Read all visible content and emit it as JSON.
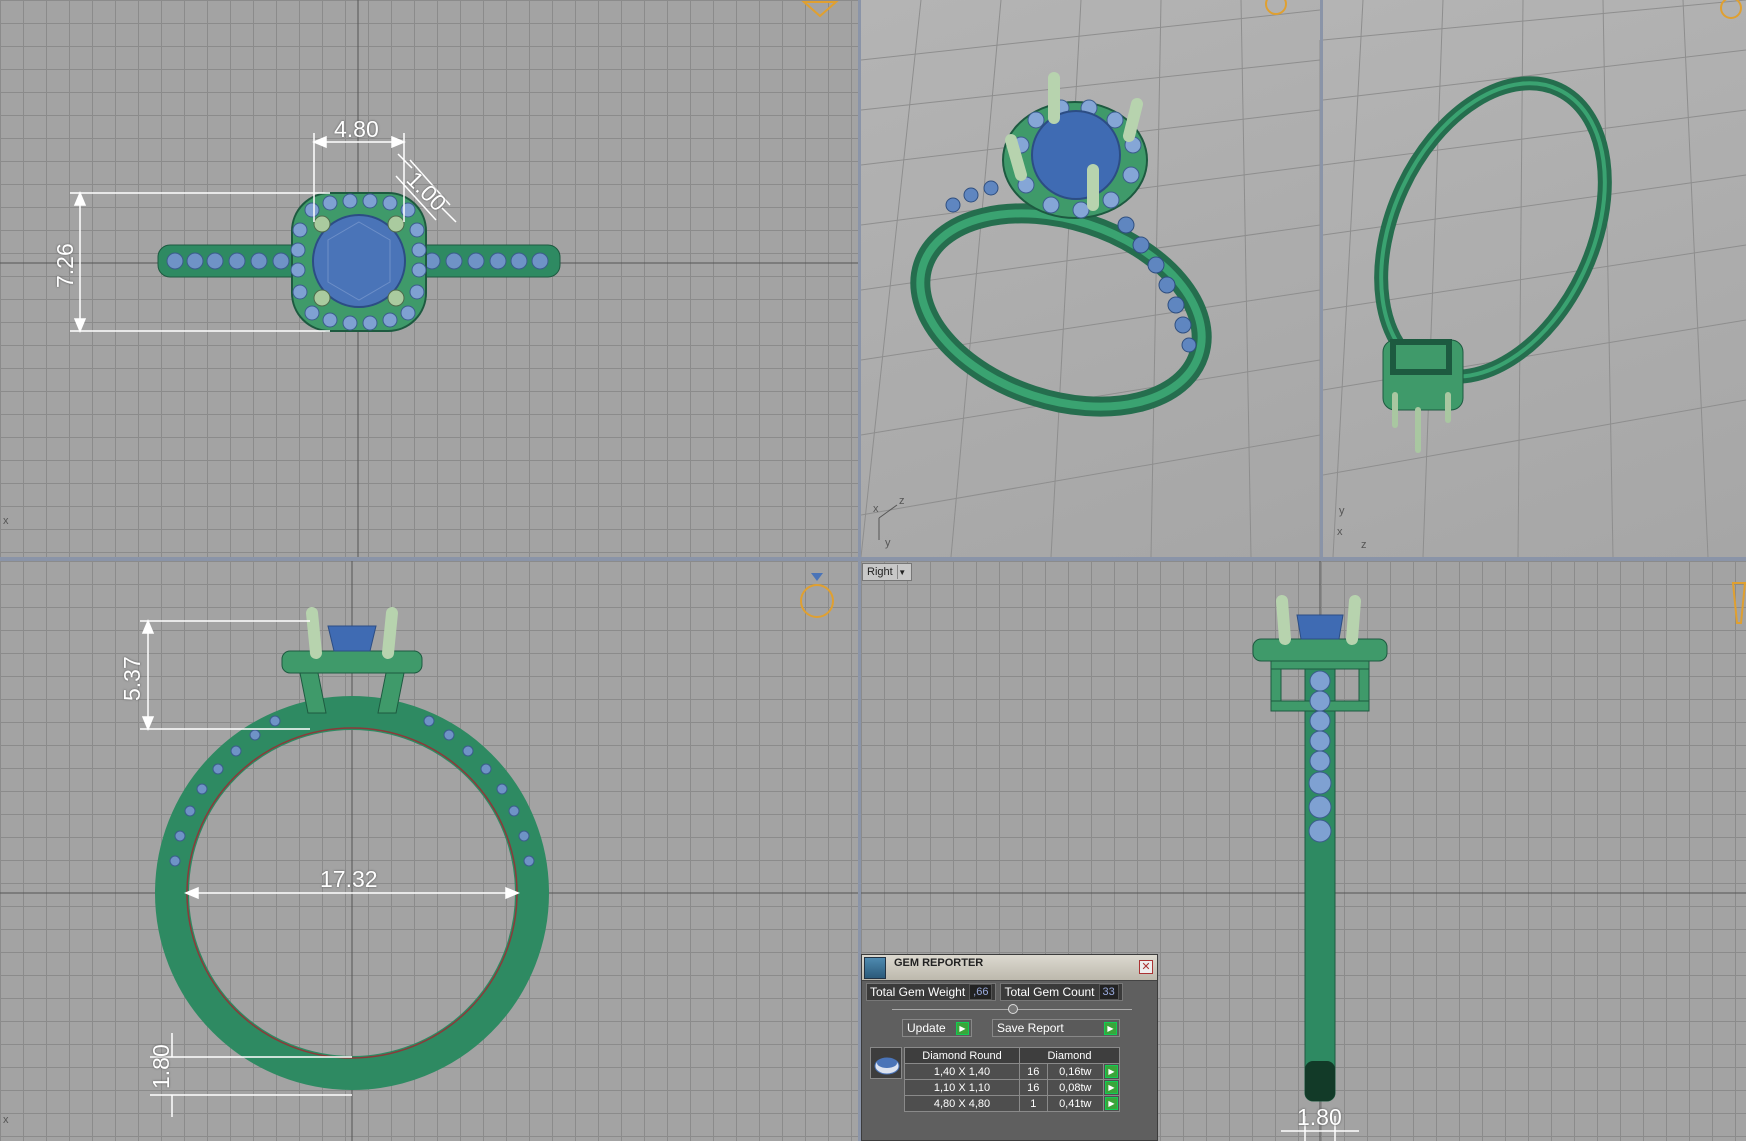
{
  "top_view": {
    "dims": {
      "width": "4.80",
      "halo": "1.00",
      "height": "7.26"
    }
  },
  "front_view": {
    "dims": {
      "head": "5.37",
      "inner": "17.32",
      "band": "1.80"
    }
  },
  "right_view": {
    "view_selector": {
      "label": "Right"
    },
    "dims": {
      "band": "1.80"
    }
  },
  "axes": {
    "top_left": "x",
    "persp1": [
      "x",
      "z",
      "y"
    ],
    "persp2": [
      "y",
      "x",
      "z"
    ],
    "front": "x"
  },
  "gem_reporter": {
    "title": "GEM REPORTER",
    "total_weight_label": "Total Gem Weight",
    "total_weight_value": ",66",
    "total_count_label": "Total Gem Count",
    "total_count_value": "33",
    "update_label": "Update",
    "save_label": "Save Report",
    "table_header": {
      "shape": "Diamond Round",
      "material": "Diamond"
    },
    "rows": [
      {
        "size": "1,40 X 1,40",
        "count": "16",
        "weight": "0,16tw"
      },
      {
        "size": "1,10 X 1,10",
        "count": "16",
        "weight": "0,08tw"
      },
      {
        "size": "4,80 X 4,80",
        "count": "1",
        "weight": "0,41tw"
      }
    ]
  },
  "colors": {
    "metal": "#2e8a62",
    "gem": "#4a74b8",
    "prong": "#9cbf96",
    "background": "#a3a3a3",
    "gridline": "#8b8b8b",
    "dimension": "#ffffff",
    "go_button": "#3aa53a"
  }
}
